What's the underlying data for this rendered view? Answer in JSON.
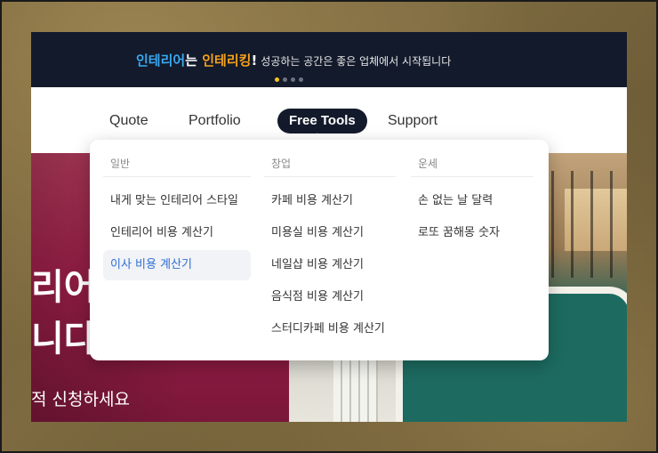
{
  "banner": {
    "brand1": "인테리어",
    "brand_mid": "는 ",
    "brand2": "인테리킹",
    "brand_end": "!",
    "tagline": "성공하는 공간은 좋은 업체에서 시작됩니다",
    "colors": {
      "blue": "#3aa8f0",
      "orange": "#f6a21a",
      "bg": "#131a2b",
      "dot_active": "#f6c21a"
    }
  },
  "nav": {
    "items": [
      {
        "label": "Quote"
      },
      {
        "label": "Portfolio"
      },
      {
        "label": "Free Tools"
      },
      {
        "label": "Support"
      }
    ]
  },
  "hero": {
    "line1": "리어,",
    "line2": "니다",
    "line3": "적 신청하세요"
  },
  "dropdown": {
    "columns": [
      {
        "heading": "일반",
        "items": [
          {
            "label": "내게 맞는 인테리어 스타일"
          },
          {
            "label": "인테리어 비용 계산기"
          },
          {
            "label": "이사 비용 계산기"
          }
        ]
      },
      {
        "heading": "창업",
        "items": [
          {
            "label": "카페 비용 계산기"
          },
          {
            "label": "미용실 비용 계산기"
          },
          {
            "label": "네일샵 비용 계산기"
          },
          {
            "label": "음식점 비용 계산기"
          },
          {
            "label": "스터디카페 비용 계산기"
          }
        ]
      },
      {
        "heading": "운세",
        "items": [
          {
            "label": "손 없는 날 달력"
          },
          {
            "label": "로또 꿈해몽 숫자"
          }
        ]
      }
    ],
    "active_color": "#2f6fd6"
  }
}
